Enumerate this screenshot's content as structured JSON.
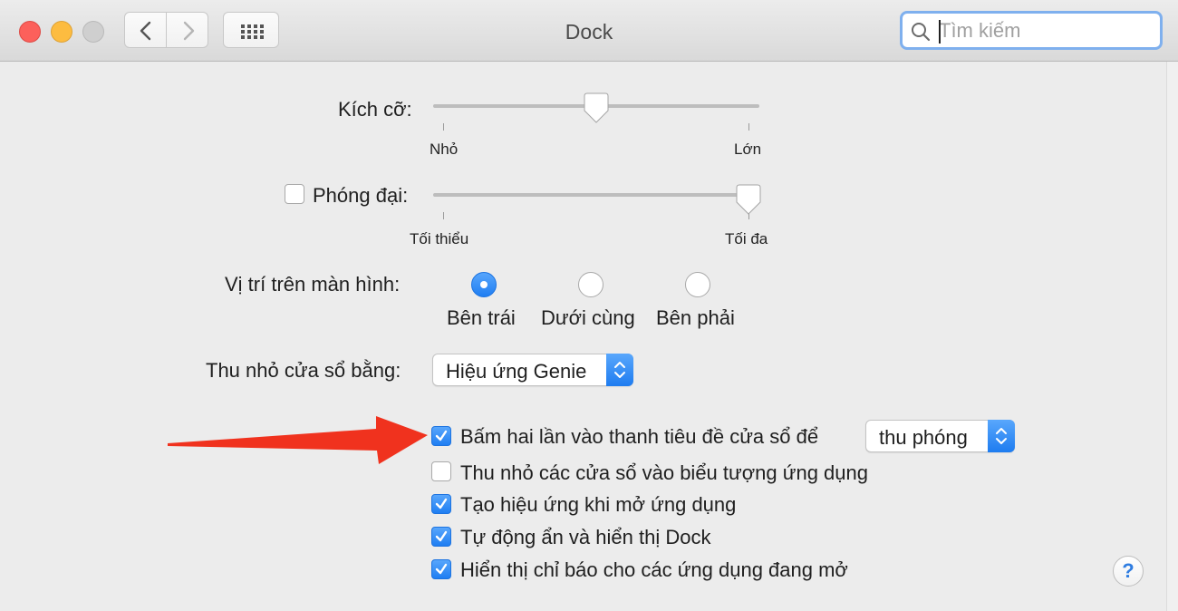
{
  "window": {
    "title": "Dock",
    "search_placeholder": "Tìm kiếm",
    "search_value": ""
  },
  "size": {
    "label": "Kích cỡ:",
    "min_label": "Nhỏ",
    "max_label": "Lớn",
    "value_fraction": 0.5
  },
  "magnification": {
    "label": "Phóng đại:",
    "checked": false,
    "min_label": "Tối thiểu",
    "max_label": "Tối đa",
    "value_fraction": 1.0
  },
  "position": {
    "label": "Vị trí trên màn hình:",
    "options": [
      {
        "label": "Bên trái",
        "selected": true
      },
      {
        "label": "Dưới cùng",
        "selected": false
      },
      {
        "label": "Bên phải",
        "selected": false
      }
    ]
  },
  "minimize": {
    "label": "Thu nhỏ cửa sổ bằng:",
    "value": "Hiệu ứng Genie"
  },
  "checkboxes": [
    {
      "label": "Bấm hai lần vào thanh tiêu đề cửa sổ để",
      "checked": true,
      "popup_value": "thu phóng"
    },
    {
      "label": "Thu nhỏ các cửa sổ vào biểu tượng ứng dụng",
      "checked": false
    },
    {
      "label": "Tạo hiệu ứng khi mở ứng dụng",
      "checked": true
    },
    {
      "label": "Tự động ẩn và hiển thị Dock",
      "checked": true
    },
    {
      "label": "Hiển thị chỉ báo cho các ứng dụng đang mở",
      "checked": true
    }
  ],
  "help_label": "?",
  "colors": {
    "accent": "#1f7ef2",
    "annotation_arrow": "#f0321e"
  }
}
